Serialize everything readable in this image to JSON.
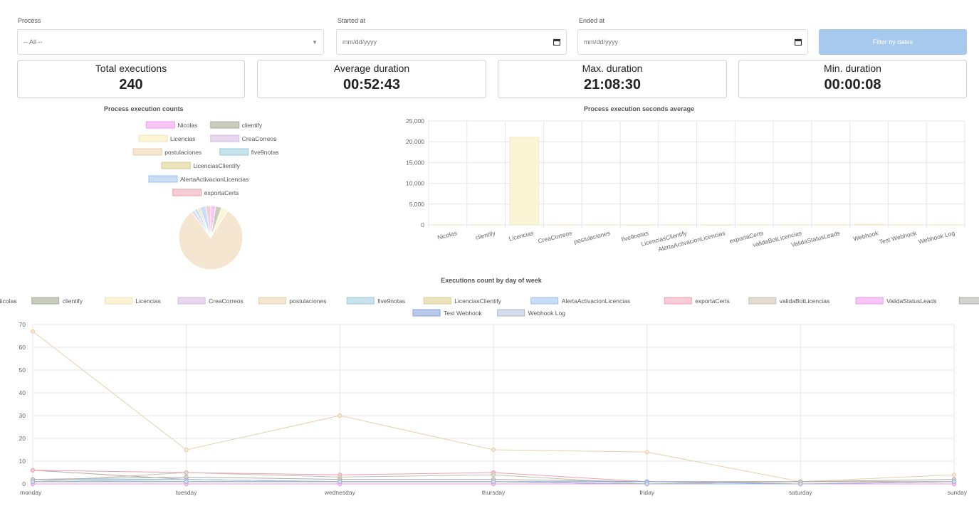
{
  "filters": {
    "process_label": "Process",
    "process_value": "-- All --",
    "started_label": "Started at",
    "started_placeholder": "mm/dd/yyyy",
    "ended_label": "Ended at",
    "ended_placeholder": "mm/dd/yyyy",
    "filter_button_label": "Filter by dates"
  },
  "stats": [
    {
      "label": "Total executions",
      "value": "240"
    },
    {
      "label": "Average duration",
      "value": "00:52:43"
    },
    {
      "label": "Max. duration",
      "value": "21:08:30"
    },
    {
      "label": "Min. duration",
      "value": "00:00:08"
    }
  ],
  "colors": {
    "button": "#a7c9ee"
  },
  "chart_data": [
    {
      "type": "pie",
      "title": "Process execution counts",
      "legend_position": "top",
      "legend_rows": [
        [
          0,
          1
        ],
        [
          2,
          3
        ],
        [
          4,
          5
        ],
        [
          6
        ],
        [
          7
        ],
        [
          8
        ]
      ],
      "series": [
        {
          "name": "Nicolas",
          "value": 6,
          "color": "#f7c6f4",
          "border": "#f39bef"
        },
        {
          "name": "clientify",
          "value": 7,
          "color": "#c8ccbd",
          "border": "#a9ae9b"
        },
        {
          "name": "Licencias",
          "value": 8,
          "color": "#fbf5d6",
          "border": "#ede3b1"
        },
        {
          "name": "CreaCorreos",
          "value": 4,
          "color": "#e8d8ef",
          "border": "#d3bde0"
        },
        {
          "name": "postulaciones",
          "value": 190,
          "color": "#f5e6d1",
          "border": "#e8d0ad"
        },
        {
          "name": "five9notas",
          "value": 4,
          "color": "#c6e2ea",
          "border": "#9ccad8"
        },
        {
          "name": "LicenciasClientify",
          "value": 3,
          "color": "#ede3bc",
          "border": "#d9cb8f"
        },
        {
          "name": "AlertaActivacionLicencias",
          "value": 7,
          "color": "#c9ddf7",
          "border": "#9dc0ee"
        },
        {
          "name": "exportaCerts",
          "value": 6,
          "color": "#f6ccd7",
          "border": "#ee9fb3"
        }
      ]
    },
    {
      "type": "bar",
      "title": "Process execution seconds average",
      "categories": [
        "Nicolas",
        "clientify",
        "Licencias",
        "CreaCorreos",
        "postulaciones",
        "five9notas",
        "LicenciasClientify",
        "AlertaActivacionLicencias",
        "exportaCerts",
        "validaBotLicencias",
        "ValidaStatusLeads",
        "Webhook",
        "Test Webhook",
        "Webhook Log"
      ],
      "values": [
        20,
        30,
        21100,
        15,
        40,
        12,
        25,
        10,
        30,
        20,
        15,
        150,
        60,
        40
      ],
      "bar_color": "#fbf5d6",
      "bar_border": "#ede3b1",
      "yticks": [
        "0",
        "5,000",
        "10,000",
        "15,000",
        "20,000",
        "25,000"
      ],
      "ylim": [
        0,
        25000
      ],
      "grid": true
    },
    {
      "type": "line",
      "title": "Executions count by day of week",
      "legend_position": "top",
      "categories": [
        "monday",
        "tuesday",
        "wednesday",
        "thursday",
        "friday",
        "saturday",
        "sunday"
      ],
      "yticks": [
        "0",
        "10",
        "20",
        "30",
        "40",
        "50",
        "60",
        "70"
      ],
      "ylim": [
        0,
        70
      ],
      "grid": true,
      "series": [
        {
          "name": "Nicolas",
          "color": "#f7c6f4",
          "border": "#f39bef",
          "values": [
            1,
            1,
            1,
            1,
            0,
            0,
            0
          ]
        },
        {
          "name": "clientify",
          "color": "#c8ccbd",
          "border": "#a9ae9b",
          "values": [
            6,
            2,
            1,
            1,
            0,
            1,
            1
          ]
        },
        {
          "name": "Licencias",
          "color": "#fbf5d6",
          "border": "#ede3b1",
          "values": [
            1,
            2,
            1,
            1,
            0,
            0,
            1
          ]
        },
        {
          "name": "CreaCorreos",
          "color": "#e8d8ef",
          "border": "#d3bde0",
          "values": [
            1,
            1,
            1,
            1,
            0,
            0,
            0
          ]
        },
        {
          "name": "postulaciones",
          "color": "#f5e6d1",
          "border": "#e8d0ad",
          "values": [
            67,
            15,
            30,
            15,
            14,
            1,
            4
          ]
        },
        {
          "name": "five9notas",
          "color": "#c6e2ea",
          "border": "#9ccad8",
          "values": [
            1,
            2,
            1,
            1,
            0,
            0,
            0
          ]
        },
        {
          "name": "LicenciasClientify",
          "color": "#ede3bc",
          "border": "#d9cb8f",
          "values": [
            1,
            1,
            1,
            1,
            0,
            0,
            0
          ]
        },
        {
          "name": "AlertaActivacionLicencias",
          "color": "#c9ddf7",
          "border": "#9dc0ee",
          "values": [
            2,
            2,
            1,
            1,
            0,
            1,
            1
          ]
        },
        {
          "name": "exportaCerts",
          "color": "#f6ccd7",
          "border": "#ee9fb3",
          "values": [
            6,
            5,
            4,
            5,
            1,
            1,
            1
          ]
        },
        {
          "name": "validaBotLicencias",
          "color": "#e3ddd1",
          "border": "#c8bfad",
          "values": [
            1,
            5,
            3,
            4,
            0,
            1,
            1
          ]
        },
        {
          "name": "ValidaStatusLeads",
          "color": "#f5c6f7",
          "border": "#ec99ef",
          "values": [
            0,
            0,
            0,
            0,
            0,
            0,
            0
          ]
        },
        {
          "name": "Webhook",
          "color": "#d2d3cf",
          "border": "#acaea7",
          "values": [
            2,
            3,
            2,
            2,
            1,
            1,
            2
          ]
        },
        {
          "name": "Test Webhook",
          "color": "#b9c9ec",
          "border": "#8aa4dd",
          "values": [
            1,
            1,
            1,
            1,
            1,
            0,
            1
          ]
        },
        {
          "name": "Webhook Log",
          "color": "#d5dcea",
          "border": "#aab7d0",
          "values": [
            1,
            1,
            1,
            1,
            0,
            0,
            1
          ]
        }
      ]
    }
  ]
}
